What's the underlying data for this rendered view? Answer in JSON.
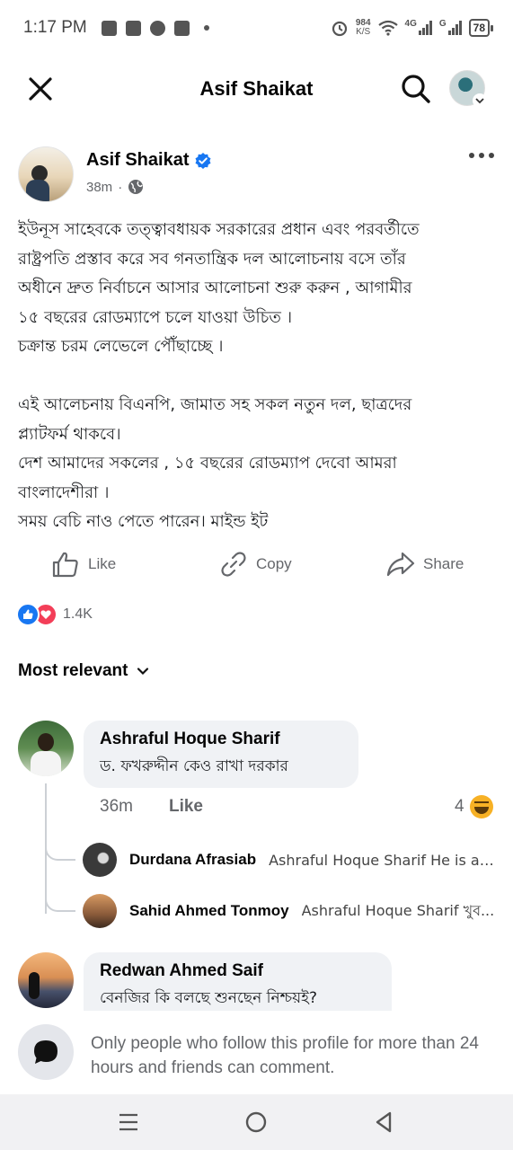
{
  "status_bar": {
    "time": "1:17 PM",
    "net_speed_value": "984",
    "net_speed_unit": "K/S",
    "network_label_1": "4G",
    "network_label_2": "G",
    "battery": "78"
  },
  "header": {
    "title": "Asif Shaikat"
  },
  "post": {
    "author": "Asif Shaikat",
    "time": "38m",
    "paragraph1": [
      "ইউনূস সাহেবকে তত্ত্বাবধায়ক সরকারের প্রধান এবং পরবর্তীতে",
      "রাষ্ট্রপতি প্রস্তাব করে সব গনতান্ত্রিক দল আলোচনায় বসে তাঁর",
      "অধীনে দ্রুত নির্বাচনে আসার আলোচনা শুরু করুন ,  আগামীর",
      "১৫ বছরের রোডম্যাপে চলে যাওয়া উচিত ।",
      "চক্রান্ত চরম লেভেলে পৌঁছাচ্ছে ।"
    ],
    "paragraph2": [
      "এই আলেচনায় বিএনপি, জামাত সহ সকল নতুন দল, ছাত্রদের",
      "প্ল্যাটফর্ম থাকবে।",
      "দেশ আমাদের সকলের , ১৫ বছরের রোডম্যাপ দেবো আমরা",
      "বাংলাদেশীরা ।",
      "সময় বেচি নাও পেতে পারেন। মাইন্ড ইট"
    ]
  },
  "actions": {
    "like": "Like",
    "copy": "Copy",
    "share": "Share"
  },
  "reactions": {
    "count": "1.4K"
  },
  "comments_sort": {
    "label": "Most relevant"
  },
  "comments": [
    {
      "name": "Ashraful Hoque Sharif",
      "text": "ড. ফখরুদ্দীন কেও রাখা দরকার",
      "time": "36m",
      "like_label": "Like",
      "reaction_count": "4",
      "replies": [
        {
          "name": "Durdana Afrasiab",
          "text": "Ashraful Hoque Sharif He is a t..."
        },
        {
          "name": "Sahid Ahmed Tonmoy",
          "text": "Ashraful Hoque Sharif খুব..."
        }
      ]
    },
    {
      "name": "Redwan Ahmed Saif",
      "text": "বেনজির কি বলছে শুনছেন নিশ্চয়ই?"
    }
  ],
  "notice": {
    "text": "Only people who follow this profile for more than 24 hours and friends can comment."
  },
  "colors": {
    "facebook_blue": "#1877f2",
    "love_red": "#f33e58",
    "bubble_gray": "#f0f2f5",
    "secondary_text": "#65676b"
  },
  "icons": {
    "close": "close-icon",
    "search": "search-icon",
    "verified": "verified-badge-icon",
    "globe": "globe-icon",
    "more": "more-dots-icon",
    "like": "thumbs-up-icon",
    "copy": "link-icon",
    "share": "share-arrow-icon",
    "chat": "chat-bubble-icon"
  }
}
